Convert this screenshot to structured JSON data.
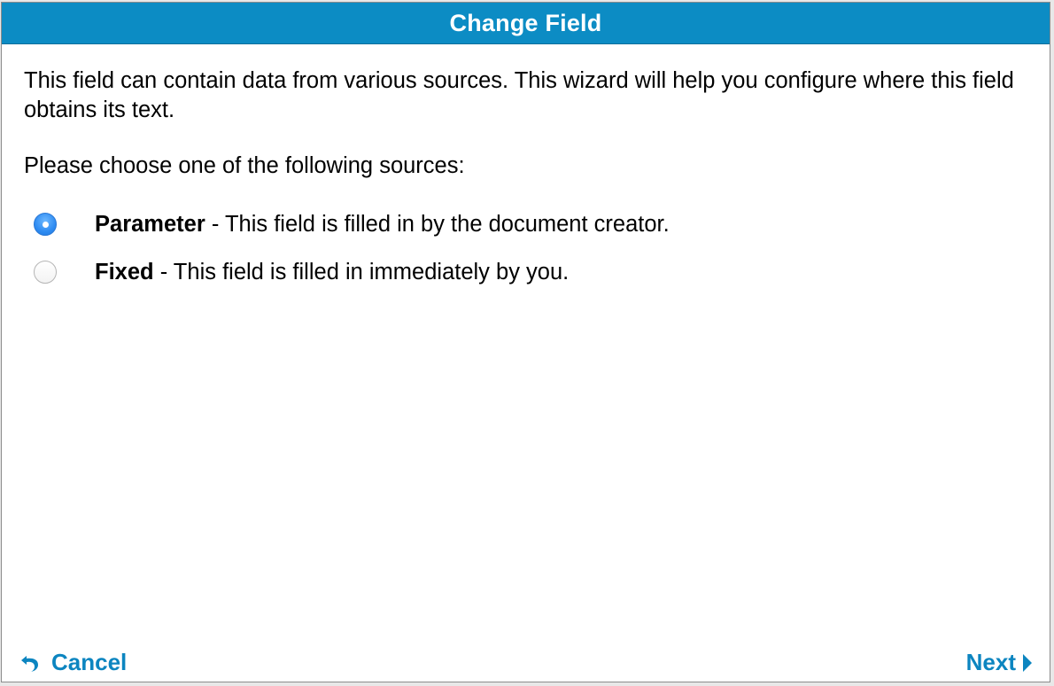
{
  "dialog": {
    "title": "Change Field",
    "intro": "This field can contain data from various sources. This wizard will help you configure where this field obtains its text.",
    "prompt": "Please choose one of the following sources:",
    "options": [
      {
        "name": "Parameter",
        "description": " - This field is filled in by the document creator.",
        "selected": true
      },
      {
        "name": "Fixed",
        "description": " - This field is filled in immediately by you.",
        "selected": false
      }
    ],
    "footer": {
      "cancel_label": "Cancel",
      "cancel_icon": "undo-arrow-icon",
      "next_label": "Next",
      "next_icon": "triangle-right-icon"
    },
    "colors": {
      "accent": "#0c8cc4",
      "link": "#0c85c0"
    }
  }
}
